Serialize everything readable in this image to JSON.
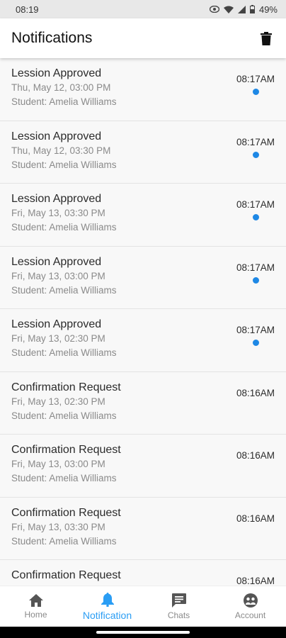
{
  "status_bar": {
    "time": "08:19",
    "battery": "49%"
  },
  "header": {
    "title": "Notifications"
  },
  "notifications": [
    {
      "title": "Lession Approved",
      "datetime": "Thu, May 12, 03:00 PM",
      "student": "Student: Amelia Williams",
      "time": "08:17AM",
      "unread": true
    },
    {
      "title": "Lession Approved",
      "datetime": "Thu, May 12, 03:30 PM",
      "student": "Student: Amelia Williams",
      "time": "08:17AM",
      "unread": true
    },
    {
      "title": "Lession Approved",
      "datetime": "Fri, May 13, 03:30 PM",
      "student": "Student: Amelia Williams",
      "time": "08:17AM",
      "unread": true
    },
    {
      "title": "Lession Approved",
      "datetime": "Fri, May 13, 03:00 PM",
      "student": "Student: Amelia Williams",
      "time": "08:17AM",
      "unread": true
    },
    {
      "title": "Lession Approved",
      "datetime": "Fri, May 13, 02:30 PM",
      "student": "Student: Amelia Williams",
      "time": "08:17AM",
      "unread": true
    },
    {
      "title": "Confirmation Request",
      "datetime": "Fri, May 13, 02:30 PM",
      "student": "Student: Amelia Williams",
      "time": "08:16AM",
      "unread": false
    },
    {
      "title": "Confirmation Request",
      "datetime": "Fri, May 13, 03:00 PM",
      "student": "Student: Amelia Williams",
      "time": "08:16AM",
      "unread": false
    },
    {
      "title": "Confirmation Request",
      "datetime": "Fri, May 13, 03:30 PM",
      "student": "Student: Amelia Williams",
      "time": "08:16AM",
      "unread": false
    },
    {
      "title": "Confirmation Request",
      "datetime": "",
      "student": "",
      "time": "08:16AM",
      "unread": false
    }
  ],
  "bottom_nav": [
    {
      "label": "Home",
      "icon": "home-icon",
      "active": false
    },
    {
      "label": "Notification",
      "icon": "bell-icon",
      "active": true
    },
    {
      "label": "Chats",
      "icon": "chat-icon",
      "active": false
    },
    {
      "label": "Account",
      "icon": "account-icon",
      "active": false
    }
  ],
  "colors": {
    "accent": "#2a9df4",
    "unread_dot": "#1e88e5"
  }
}
